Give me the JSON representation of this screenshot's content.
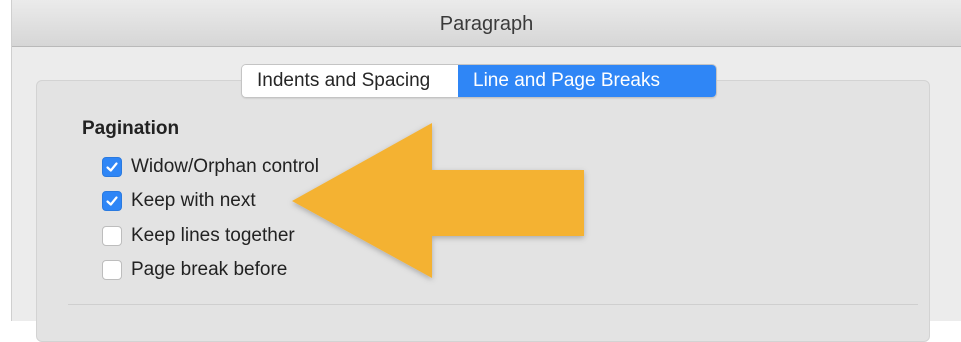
{
  "dialog": {
    "title": "Paragraph"
  },
  "tabs": [
    {
      "label": "Indents and Spacing",
      "selected": false
    },
    {
      "label": "Line and Page Breaks",
      "selected": true
    }
  ],
  "pagination": {
    "heading": "Pagination",
    "options": [
      {
        "label": "Widow/Orphan control",
        "checked": true
      },
      {
        "label": "Keep with next",
        "checked": true
      },
      {
        "label": "Keep lines together",
        "checked": false
      },
      {
        "label": "Page break before",
        "checked": false
      }
    ]
  },
  "colors": {
    "accent": "#2f86f6",
    "arrow": "#f4b233"
  },
  "annotation": {
    "icon": "arrow-left-icon"
  }
}
